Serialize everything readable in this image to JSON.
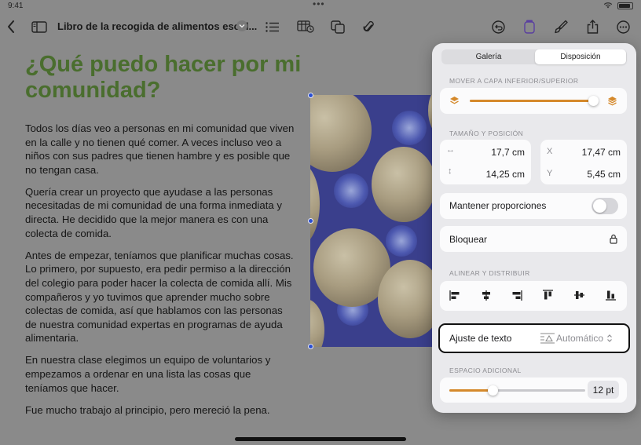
{
  "status_bar": {
    "time": "9:41",
    "dots": "•••"
  },
  "toolbar": {
    "doc_title": "Libro de la recogida de alimentos escol...",
    "icons": [
      "back-icon",
      "sidebar-icon",
      "list-icon",
      "table-media-icon",
      "shapes-icon",
      "attachment-icon",
      "undo-icon",
      "color-fill-icon",
      "paintbrush-icon",
      "share-icon",
      "more-icon"
    ]
  },
  "document": {
    "heading": "¿Qué puedo hacer por mi comunidad?",
    "paragraphs": [
      "Todos los días veo a personas en mi comunidad que viven en la calle y no tienen qué comer. A veces incluso veo a niños con sus padres que tienen hambre y es posible que no tengan casa.",
      "Quería crear un proyecto que ayudase a las personas necesitadas de mi comunidad de una forma inmediata y directa. He decidido que la mejor manera es con una colecta de comida.",
      "Antes de empezar, teníamos que planificar muchas cosas. Lo primero, por supuesto, era pedir permiso a la dirección del colegio para poder hacer la colecta de comida allí. Mis compañeros y yo tuvimos que aprender mucho sobre colectas de comida, así que hablamos con las personas de nuestra comunidad expertas en programas de ayuda alimentaria.",
      "En nuestra clase elegimos un equipo de voluntarios y empezamos a ordenar en una lista las cosas que teníamos que hacer.",
      "Fue mucho trabajo al principio, pero mereció la pena."
    ]
  },
  "panel": {
    "tabs": [
      {
        "label": "Galería",
        "active": false
      },
      {
        "label": "Disposición",
        "active": true
      }
    ],
    "layer_label": "MOVER A CAPA INFERIOR/SUPERIOR",
    "layer_value": 1.0,
    "size_label": "TAMAÑO Y POSICIÓN",
    "width_value": "17,7 cm",
    "height_value": "14,25 cm",
    "x_label": "X",
    "x_value": "17,47 cm",
    "y_label": "Y",
    "y_value": "5,45 cm",
    "constrain_label": "Mantener proporciones",
    "constrain_on": false,
    "lock_label": "Bloquear",
    "align_label": "ALINEAR Y DISTRIBUIR",
    "wrap_label": "Ajuste de texto",
    "wrap_value": "Automático",
    "spacing_label": "ESPACIO ADICIONAL",
    "spacing_value": "12 pt",
    "spacing_fraction": 0.32
  },
  "colors": {
    "heading": "#4a6e2e",
    "accent": "#d5892b",
    "selection": "#2a4fd1"
  }
}
